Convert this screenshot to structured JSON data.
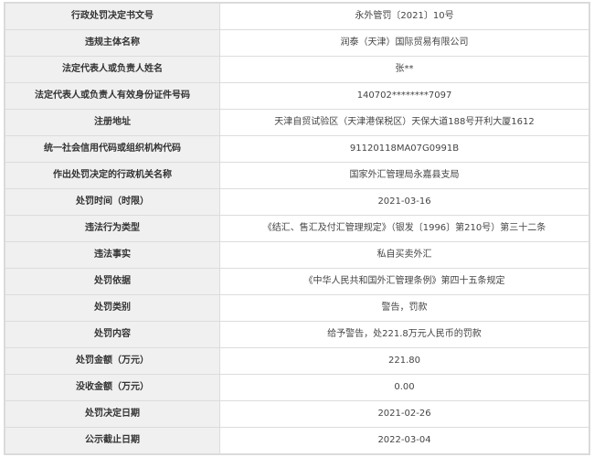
{
  "rows": [
    {
      "label": "行政处罚决定书文号",
      "value": "永外管罚〔2021〕10号"
    },
    {
      "label": "违规主体名称",
      "value": "润泰（天津）国际贸易有限公司"
    },
    {
      "label": "法定代表人或负责人姓名",
      "value": "张**"
    },
    {
      "label": "法定代表人或负责人有效身份证件号码",
      "value": "140702********7097"
    },
    {
      "label": "注册地址",
      "value": "天津自贸试验区（天津港保税区）天保大道188号开利大厦1612"
    },
    {
      "label": "统一社会信用代码或组织机构代码",
      "value": "91120118MA07G0991B"
    },
    {
      "label": "作出处罚决定的行政机关名称",
      "value": "国家外汇管理局永嘉县支局"
    },
    {
      "label": "处罚时间（时限）",
      "value": "2021-03-16"
    },
    {
      "label": "违法行为类型",
      "value": "《结汇、售汇及付汇管理规定》（银发〔1996〕第210号）第三十二条"
    },
    {
      "label": "违法事实",
      "value": "私自买卖外汇"
    },
    {
      "label": "处罚依据",
      "value": "《中华人民共和国外汇管理条例》第四十五条规定"
    },
    {
      "label": "处罚类别",
      "value": "警告，罚款"
    },
    {
      "label": "处罚内容",
      "value": "给予警告，处221.8万元人民币的罚款"
    },
    {
      "label": "处罚金额（万元）",
      "value": "221.80"
    },
    {
      "label": "没收金额（万元）",
      "value": "0.00"
    },
    {
      "label": "处罚决定日期",
      "value": "2021-02-26"
    },
    {
      "label": "公示截止日期",
      "value": "2022-03-04"
    }
  ]
}
